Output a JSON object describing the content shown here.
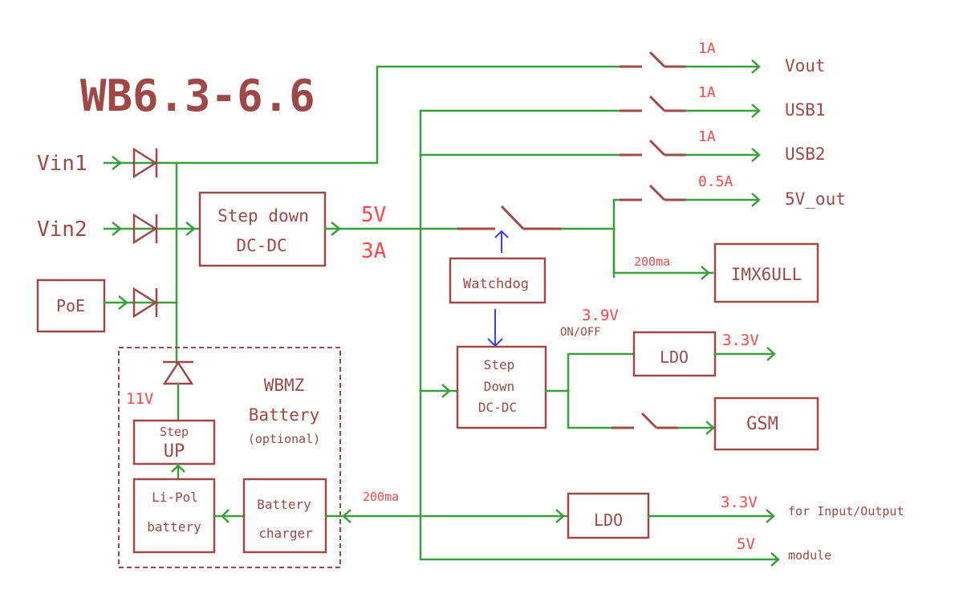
{
  "title": "WB6.3-6.6",
  "inputs": {
    "vin1": "Vin1",
    "vin2": "Vin2",
    "poe": "PoE"
  },
  "blocks": {
    "step_down_main": [
      "Step down",
      "DC-DC"
    ],
    "watchdog": "Watchdog",
    "step_down_gsm": [
      "Step",
      "Down",
      "DC-DC"
    ],
    "ldo_gsm": "LDO",
    "gsm": "GSM",
    "imx": "IMX6ULL",
    "ldo_io": "LDO",
    "step_up": [
      "Step",
      "UP"
    ],
    "lipol": [
      "Li-Pol",
      "battery"
    ],
    "charger": [
      "Battery",
      "charger"
    ]
  },
  "battery_module": {
    "title": "WBMZ",
    "subtitle": "Battery",
    "note": "(optional)",
    "voltage": "11V"
  },
  "main_rail": {
    "voltage": "5V",
    "current": "3A"
  },
  "outputs": [
    {
      "name": "Vout",
      "limit": "1A"
    },
    {
      "name": "USB1",
      "limit": "1A"
    },
    {
      "name": "USB2",
      "limit": "1A"
    },
    {
      "name": "5V_out",
      "limit": "0.5A"
    }
  ],
  "imx_current": "200ma",
  "gsm_rail": {
    "voltage": "3.9V",
    "control": "ON/OFF",
    "ldo_out": "3.3V"
  },
  "io_rail": {
    "current": "200ma",
    "voltage": "3.3V",
    "label": "for Input/Output"
  },
  "module_rail": {
    "voltage": "5V",
    "label": "module"
  },
  "colors": {
    "wire": "#3c9e3c",
    "block": "#a04848",
    "value": "#ff4848",
    "control": "#3c3cf0"
  }
}
